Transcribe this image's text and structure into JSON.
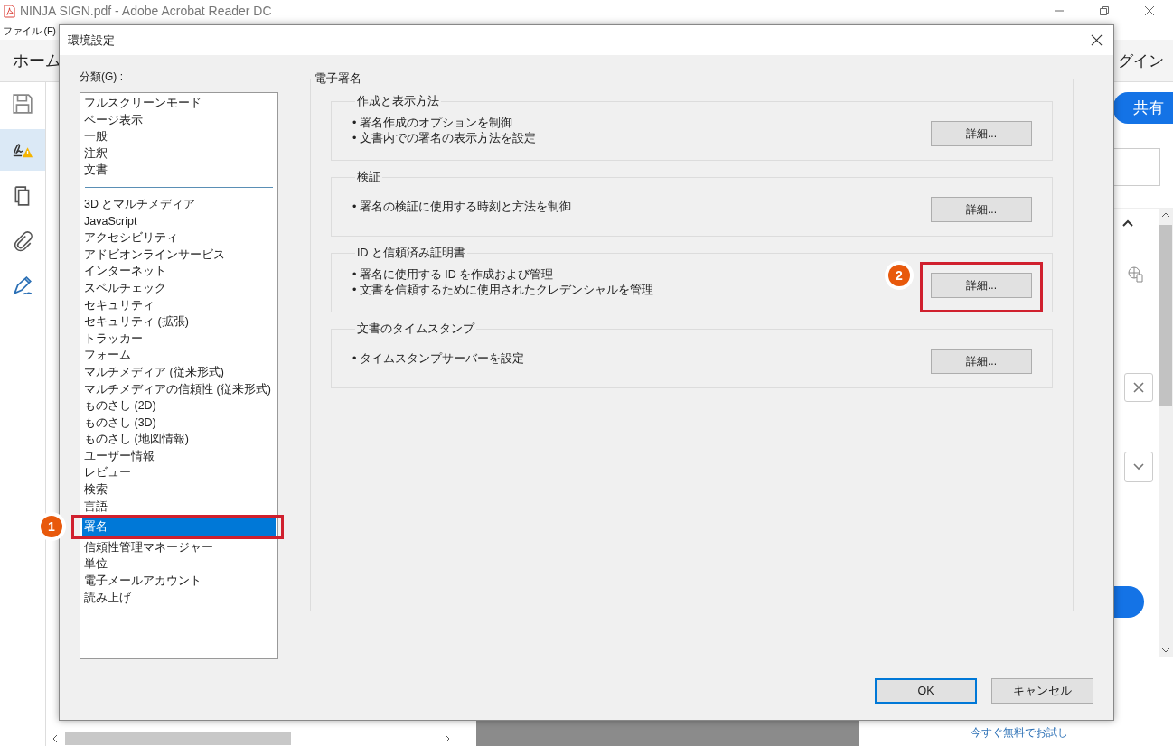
{
  "app": {
    "title": "NINJA SIGN.pdf - Adobe Acrobat Reader DC",
    "menu": [
      "ファイル (F)"
    ],
    "tab": "ホーム",
    "login": "グイン",
    "share_button": "共有",
    "trial_link": "今すぐ無料でお試し"
  },
  "dialog": {
    "title": "環境設定",
    "category_label": "分類(G) :",
    "category_groups": [
      {
        "items": [
          {
            "label": "フルスクリーンモード",
            "selected": false
          },
          {
            "label": "ページ表示",
            "selected": false
          },
          {
            "label": "一般",
            "selected": false
          },
          {
            "label": "注釈",
            "selected": false
          },
          {
            "label": "文書",
            "selected": false
          }
        ]
      },
      {
        "items": [
          {
            "label": "3D とマルチメディア",
            "selected": false
          },
          {
            "label": "JavaScript",
            "selected": false
          },
          {
            "label": "アクセシビリティ",
            "selected": false
          },
          {
            "label": "アドビオンラインサービス",
            "selected": false
          },
          {
            "label": "インターネット",
            "selected": false
          },
          {
            "label": "スペルチェック",
            "selected": false
          },
          {
            "label": "セキュリティ",
            "selected": false
          },
          {
            "label": "セキュリティ (拡張)",
            "selected": false
          },
          {
            "label": "トラッカー",
            "selected": false
          },
          {
            "label": "フォーム",
            "selected": false
          },
          {
            "label": "マルチメディア (従来形式)",
            "selected": false
          },
          {
            "label": "マルチメディアの信頼性 (従来形式)",
            "selected": false
          },
          {
            "label": "ものさし (2D)",
            "selected": false
          },
          {
            "label": "ものさし (3D)",
            "selected": false
          },
          {
            "label": "ものさし (地図情報)",
            "selected": false
          },
          {
            "label": "ユーザー情報",
            "selected": false
          },
          {
            "label": "レビュー",
            "selected": false
          },
          {
            "label": "検索",
            "selected": false
          },
          {
            "label": "言語",
            "selected": false
          },
          {
            "label": "署名",
            "selected": true,
            "callout": "1"
          },
          {
            "label": "信頼性管理マネージャー",
            "selected": false
          },
          {
            "label": "単位",
            "selected": false
          },
          {
            "label": "電子メールアカウント",
            "selected": false
          },
          {
            "label": "読み上げ",
            "selected": false
          }
        ]
      }
    ],
    "section_title": "電子署名",
    "groups": [
      {
        "title": "作成と表示方法",
        "bullets": [
          "• 署名作成のオプションを制御",
          "• 文書内での署名の表示方法を設定"
        ],
        "button": "詳細..."
      },
      {
        "title": "検証",
        "bullets": [
          "• 署名の検証に使用する時刻と方法を制御"
        ],
        "button": "詳細..."
      },
      {
        "title": "ID と信頼済み証明書",
        "bullets": [
          "• 署名に使用する ID を作成および管理",
          "• 文書を信頼するために使用されたクレデンシャルを管理"
        ],
        "button": "詳細...",
        "callout": "2"
      },
      {
        "title": "文書のタイムスタンプ",
        "bullets": [
          "• タイムスタンプサーバーを設定"
        ],
        "button": "詳細..."
      }
    ],
    "buttons": [
      {
        "label": "OK",
        "default": true
      },
      {
        "label": "キャンセル",
        "default": false
      }
    ]
  }
}
